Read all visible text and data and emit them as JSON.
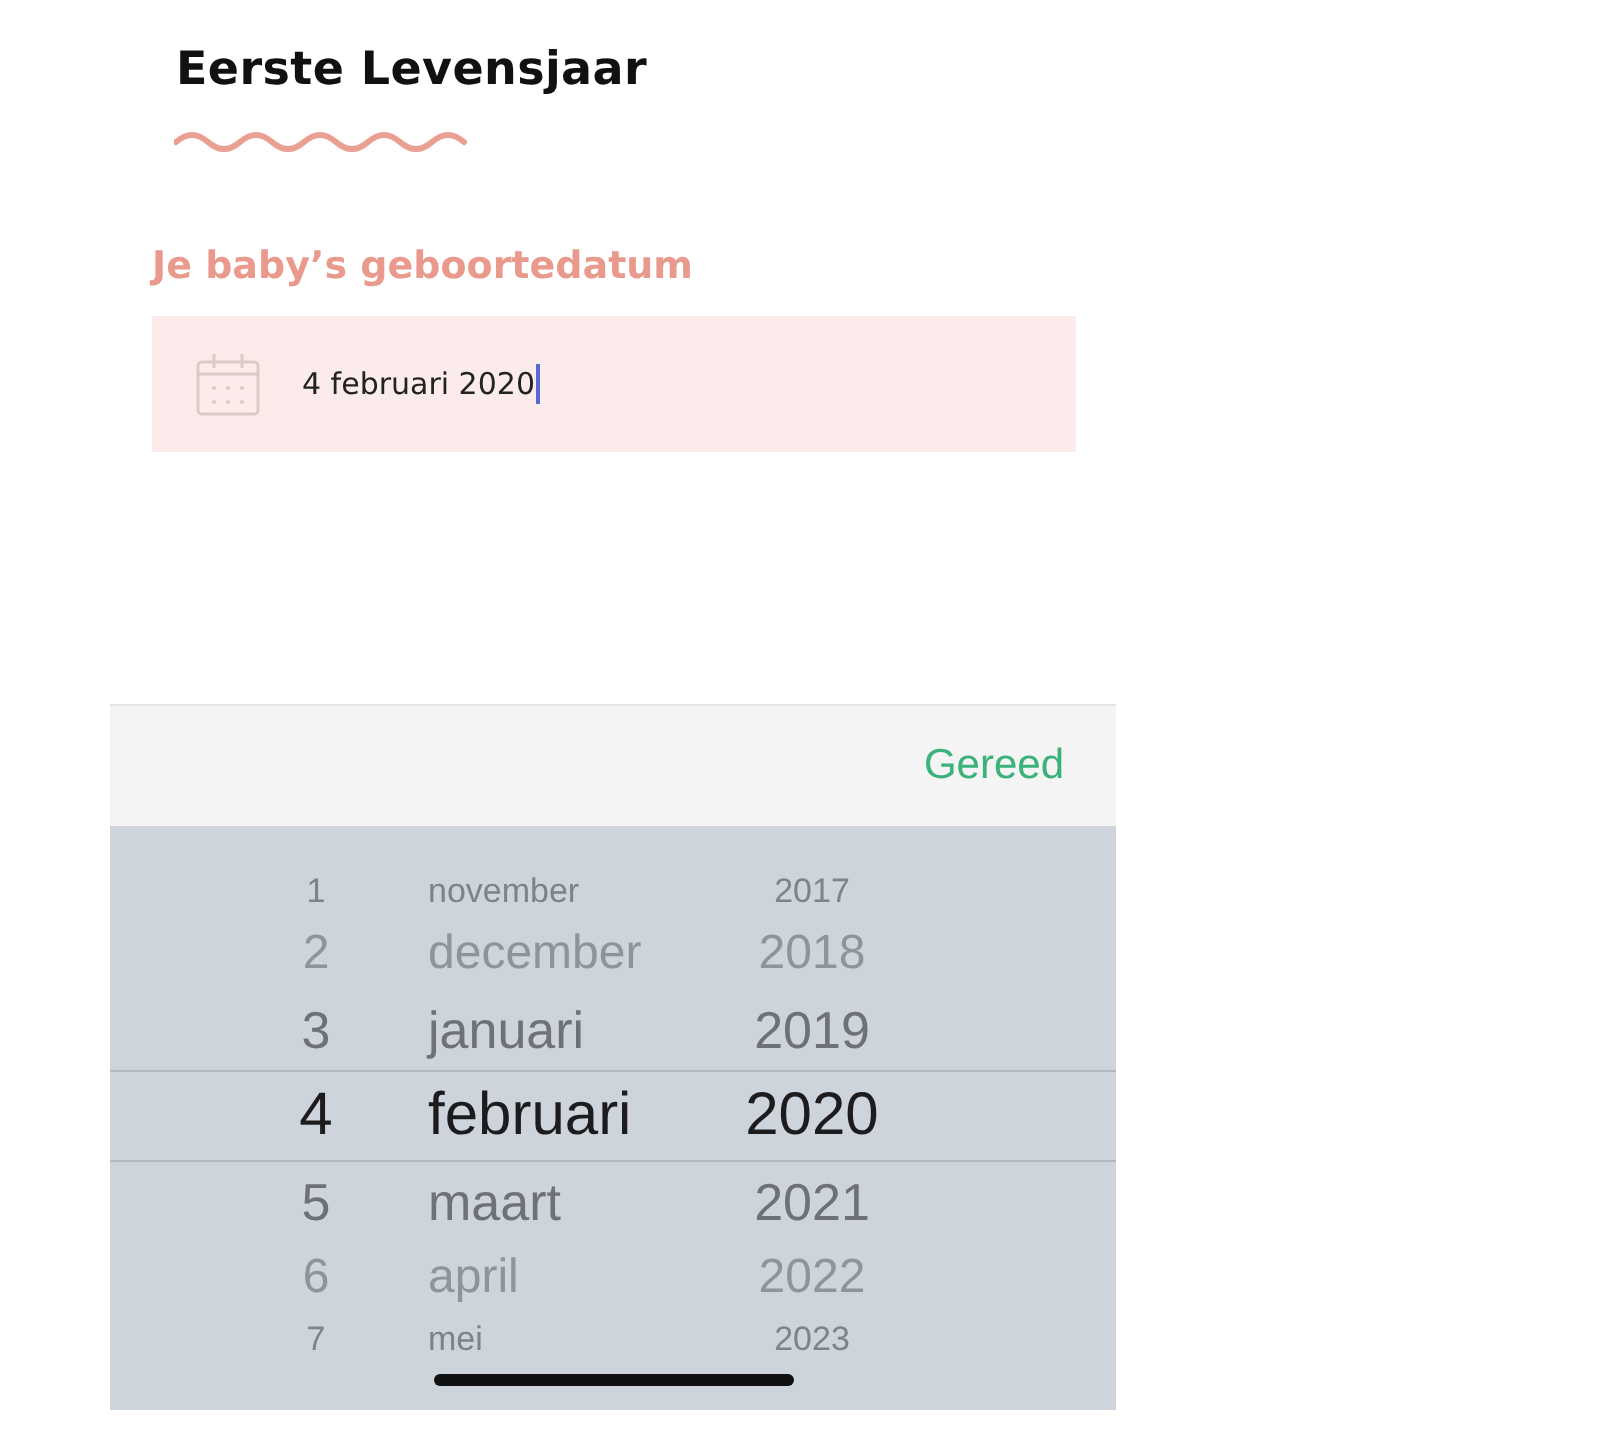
{
  "header": {
    "title": "Eerste Levensjaar"
  },
  "birthdate": {
    "label": "Je baby’s geboortedatum",
    "value": "4 februari 2020",
    "focused": true
  },
  "picker": {
    "done_button": "Gereed",
    "rows": [
      {
        "day": "1",
        "month": "november",
        "year": "2017",
        "selected": false
      },
      {
        "day": "2",
        "month": "december",
        "year": "2018",
        "selected": false
      },
      {
        "day": "3",
        "month": "januari",
        "year": "2019",
        "selected": false
      },
      {
        "day": "4",
        "month": "februari",
        "year": "2020",
        "selected": true
      },
      {
        "day": "5",
        "month": "maart",
        "year": "2021",
        "selected": false
      },
      {
        "day": "6",
        "month": "april",
        "year": "2022",
        "selected": false
      },
      {
        "day": "7",
        "month": "mei",
        "year": "2023",
        "selected": false
      }
    ]
  }
}
